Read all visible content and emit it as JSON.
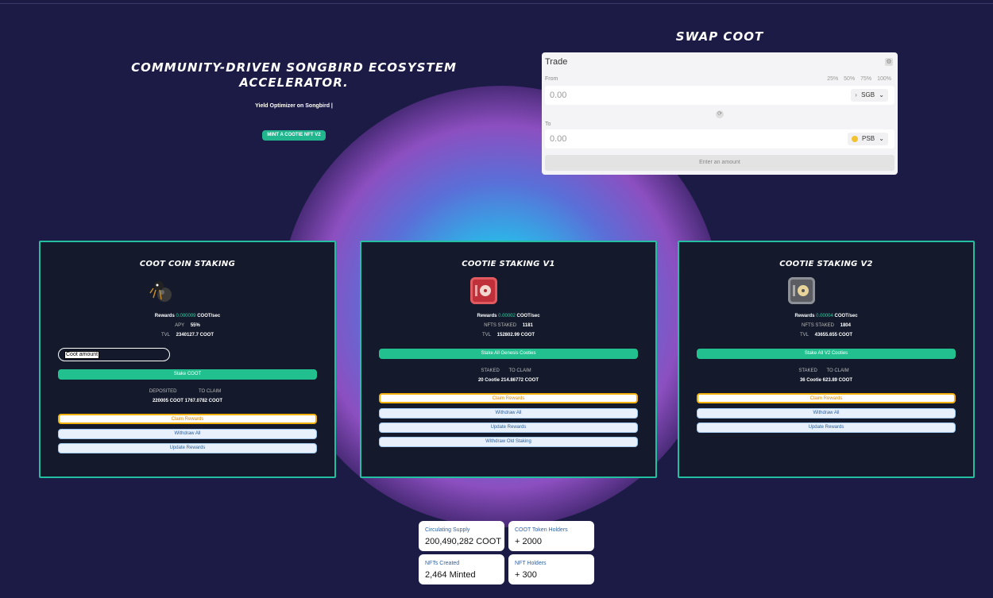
{
  "hero": {
    "title_line1": "COMMUNITY-DRIVEN SONGBIRD ECOSYSTEM",
    "title_line2": "ACCELERATOR.",
    "subtitle": "Yield Optimizer on Songbird |",
    "mint_button": "MINT A COOTIE NFT V2"
  },
  "swap": {
    "title": "SWAP COOT",
    "trade_label": "Trade",
    "from_label": "From",
    "to_label": "To",
    "percents": [
      "25%",
      "50%",
      "75%",
      "100%"
    ],
    "from_value": "0.00",
    "to_value": "0.00",
    "from_token": "SGB",
    "to_token": "PSB",
    "enter_button": "Enter an amount"
  },
  "cards": {
    "coin": {
      "title": "COOT COIN STAKING",
      "rewards_label": "Rewards",
      "rewards_rate": "0.000009",
      "rewards_unit": "COOT/sec",
      "apy_label": "APY",
      "apy_value": "55%",
      "tvl_label": "TVL",
      "tvl_value": "2340127.7 COOT",
      "input_placeholder": "Coot amount",
      "stake_button": "Stake COOT",
      "deposited_label": "DEPOSITED",
      "toclaim_label": "TO CLAIM",
      "deposited_value": "220005 COOT",
      "toclaim_value": "1767.0782 COOT",
      "claim_button": "Claim Rewards",
      "withdraw_button": "Withdraw All",
      "update_button": "Update Rewards"
    },
    "v1": {
      "title": "COOTIE STAKING V1",
      "rewards_label": "Rewards",
      "rewards_rate": "0.00002",
      "rewards_unit": "COOT/sec",
      "staked_label": "NFTS STAKED",
      "staked_value": "1181",
      "tvl_label": "TVL",
      "tvl_value": "152802.99 COOT",
      "stake_button": "Stake All Genesis Cooties",
      "staked_col": "STAKED",
      "toclaim_label": "TO CLAIM",
      "staked_count": "20 Cootie",
      "toclaim_value": "214.86772 COOT",
      "claim_button": "Claim Rewards",
      "withdraw_button": "Withdraw All",
      "update_button": "Update Rewards",
      "withdraw_old_button": "Withdraw Old Staking"
    },
    "v2": {
      "title": "COOTIE STAKING V2",
      "rewards_label": "Rewards",
      "rewards_rate": "0.00004",
      "rewards_unit": "COOT/sec",
      "staked_label": "NFTS STAKED",
      "staked_value": "1804",
      "tvl_label": "TVL",
      "tvl_value": "43655.655 COOT",
      "stake_button": "Stake All V2 Cooties",
      "staked_col": "STAKED",
      "toclaim_label": "TO CLAIM",
      "staked_count": "36 Cootie",
      "toclaim_value": "623.89 COOT",
      "claim_button": "Claim Rewards",
      "withdraw_button": "Withdraw All",
      "update_button": "Update Rewards"
    }
  },
  "stats": [
    {
      "label": "Circulating Supply",
      "value": "200,490,282 COOT"
    },
    {
      "label": "COOT Token Holders",
      "value": "+ 2000"
    },
    {
      "label": "NFTs Created",
      "value": "2,464 Minted"
    },
    {
      "label": "NFT Holders",
      "value": "+ 300"
    }
  ],
  "colors": {
    "background": "#1b1b45",
    "accent_green": "#22c08f",
    "card_border": "#22c0a1",
    "claim_orange": "#f3b10d"
  },
  "icons": [
    "coot-bird-icon",
    "red-safe-icon",
    "grey-safe-icon",
    "gear-icon",
    "swap-arrows-icon",
    "chevron-down-icon"
  ]
}
